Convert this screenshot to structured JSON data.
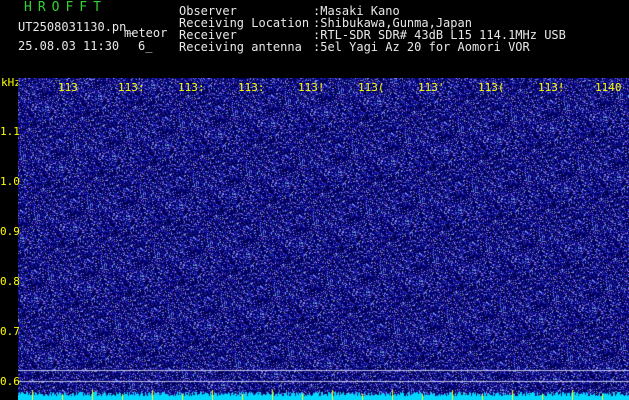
{
  "header": {
    "app_title": "HROFFT",
    "filename": "UT2508031130.pn_",
    "meteor_label": "meteor",
    "timestamp": "25.08.03 11:30",
    "count": "6_"
  },
  "info": [
    {
      "label": "Observer",
      "value": ":Masaki Kano"
    },
    {
      "label": "Receiving Location",
      "value": ":Shibukawa,Gunma,Japan"
    },
    {
      "label": "Receiver",
      "value": ":RTL-SDR SDR# 43dB L15 114.1MHz USB"
    },
    {
      "label": "Receiving antenna",
      "value": ":5el Yagi Az 20 for Aomori VOR"
    }
  ],
  "axis": {
    "y_unit": "kHz",
    "y_ticks": [
      "1.1",
      "1.0",
      "0.9",
      "0.8",
      "0.7",
      "0.6"
    ],
    "x_ticks": [
      "113",
      "113:",
      "113:",
      "113:",
      "113!",
      "113(",
      "113'",
      "113(",
      "113!",
      "1140"
    ]
  },
  "colors": {
    "background": "#000000",
    "noise_dark": "#0a0a6e",
    "noise_light": "#8c8cff",
    "label_green": "#32d232",
    "tick_yellow": "#ffff00",
    "baseline_cyan": "#00e0ff"
  }
}
